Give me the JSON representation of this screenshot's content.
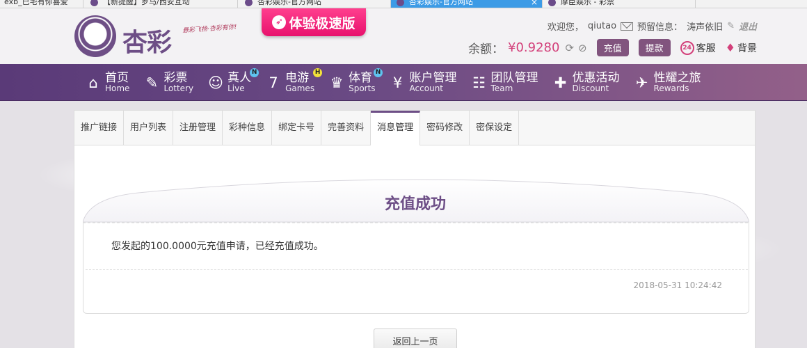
{
  "browser_tabs": [
    {
      "label": "exb_已宅有你喜爱"
    },
    {
      "label": "【新提醒】罗马/西安互动"
    },
    {
      "label": "杏彩娱乐-官方网站"
    },
    {
      "label": "杏彩娱乐-官方网站",
      "active": true,
      "close": "×"
    },
    {
      "label": "摩臣娱乐 - 彩票"
    }
  ],
  "header": {
    "logo_text": "杏彩",
    "slogan": "悬彩飞扬·杏彩有你!",
    "express_label": "体验极速版",
    "welcome_prefix": "欢迎您，",
    "username": "qiutao",
    "reserved_label": "预留信息：",
    "reserved_value": "涛声依旧",
    "logout": "退出",
    "balance_label": "余额：",
    "balance_value": "¥0.9280",
    "recharge": "充值",
    "withdraw": "提款",
    "service_badge": "24",
    "service": "客服",
    "background": "背景"
  },
  "nav": [
    {
      "cn": "首页",
      "en": "Home",
      "icon": "⌂",
      "badge": ""
    },
    {
      "cn": "彩票",
      "en": "Lottery",
      "icon": "✎",
      "badge": ""
    },
    {
      "cn": "真人",
      "en": "Live",
      "icon": "☺",
      "badge": "N"
    },
    {
      "cn": "电游",
      "en": "Games",
      "icon": "7",
      "badge": "H"
    },
    {
      "cn": "体育",
      "en": "Sports",
      "icon": "♛",
      "badge": "N"
    },
    {
      "cn": "账户管理",
      "en": "Account",
      "icon": "¥",
      "badge": ""
    },
    {
      "cn": "团队管理",
      "en": "Team",
      "icon": "☷",
      "badge": ""
    },
    {
      "cn": "优惠活动",
      "en": "Discount",
      "icon": "✚",
      "badge": ""
    },
    {
      "cn": "性耀之旅",
      "en": "Rewards",
      "icon": "✈",
      "badge": ""
    }
  ],
  "subtabs": [
    {
      "label": "推广链接"
    },
    {
      "label": "用户列表"
    },
    {
      "label": "注册管理"
    },
    {
      "label": "彩种信息"
    },
    {
      "label": "绑定卡号"
    },
    {
      "label": "完善资料"
    },
    {
      "label": "消息管理",
      "active": true
    },
    {
      "label": "密码修改"
    },
    {
      "label": "密保设定"
    }
  ],
  "message": {
    "title": "充值成功",
    "body": "您发起的100.0000元充值申请，已经充值成功。",
    "time": "2018-05-31 10:24:42"
  },
  "back_button": "返回上一页",
  "colors": {
    "brand_purple": "#6d4e86",
    "accent_pink": "#d3407a",
    "nav_gradient_start": "#5a3a78",
    "nav_gradient_end": "#936089"
  }
}
